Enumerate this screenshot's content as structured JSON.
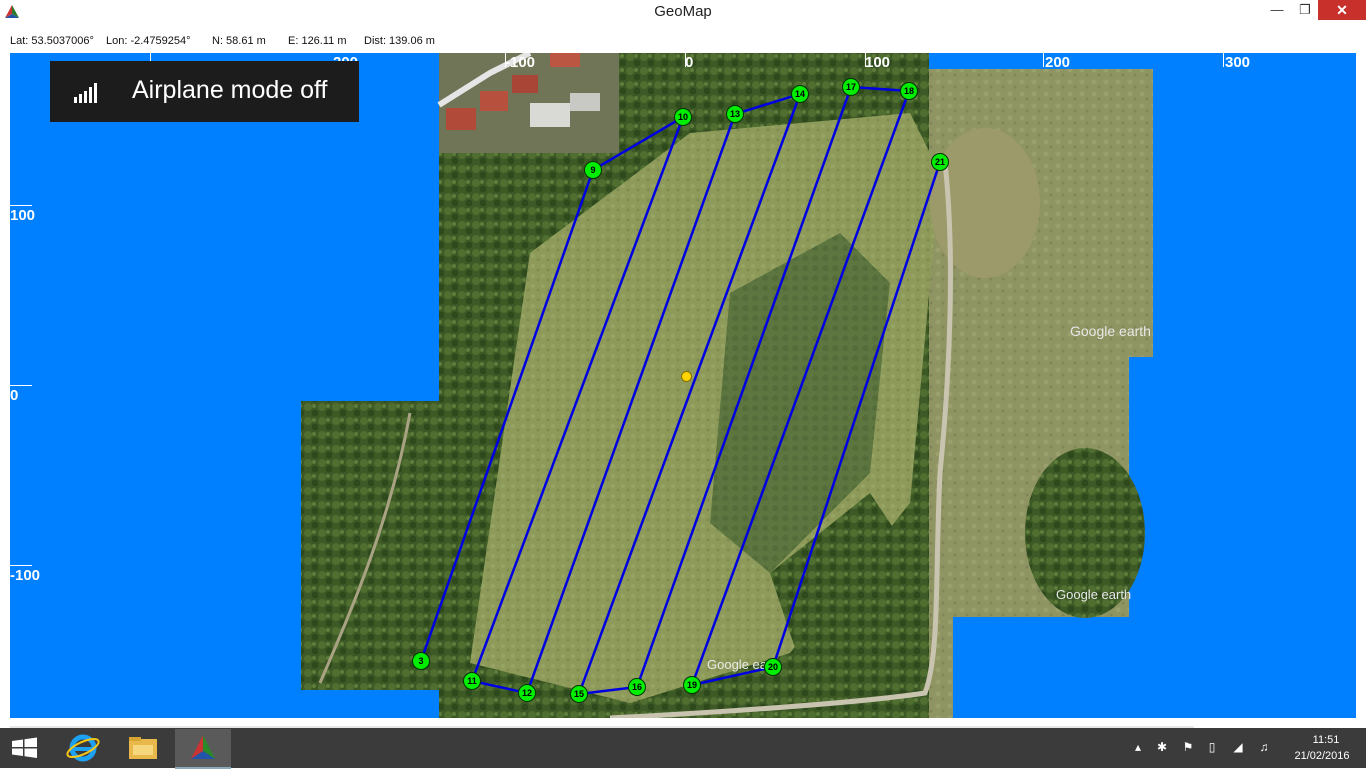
{
  "window": {
    "title": "GeoMap"
  },
  "status": {
    "lat": "Lat: 53.5037006°",
    "lon": "Lon: -2.4759254°",
    "north": "N: 58.61 m",
    "east": "E: 126.11 m",
    "dist": "Dist: 139.06 m"
  },
  "axes": {
    "x_labels": [
      "-200",
      "-100",
      "0",
      "100",
      "200",
      "300"
    ],
    "y_labels": [
      "100",
      "0",
      "-100"
    ]
  },
  "waypoints": [
    {
      "id": "3"
    },
    {
      "id": "9"
    },
    {
      "id": "10"
    },
    {
      "id": "11"
    },
    {
      "id": "12"
    },
    {
      "id": "13"
    },
    {
      "id": "14"
    },
    {
      "id": "15"
    },
    {
      "id": "16"
    },
    {
      "id": "17"
    },
    {
      "id": "18"
    },
    {
      "id": "19"
    },
    {
      "id": "20"
    },
    {
      "id": "21"
    }
  ],
  "watermarks": [
    "Google earth",
    "Google earth",
    "Google earth"
  ],
  "toast": {
    "text": "Airplane mode off"
  },
  "taskbar": {
    "time": "11:51",
    "date": "21/02/2016"
  },
  "colors": {
    "map_background": "#0080ff",
    "route": "#0000e0",
    "waypoint_fill": "#00ee00",
    "close_button": "#c7302b"
  }
}
